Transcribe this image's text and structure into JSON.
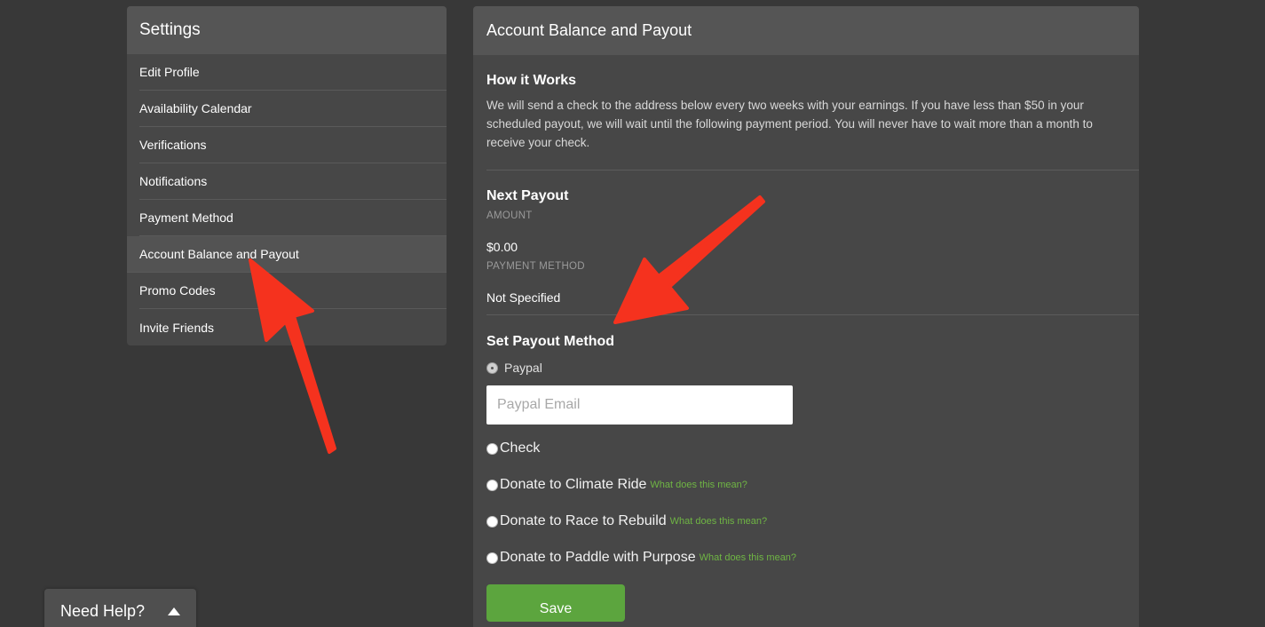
{
  "sidebar": {
    "title": "Settings",
    "items": [
      {
        "label": "Edit Profile"
      },
      {
        "label": "Availability Calendar"
      },
      {
        "label": "Verifications"
      },
      {
        "label": "Notifications"
      },
      {
        "label": "Payment Method"
      },
      {
        "label": "Account Balance and Payout",
        "active": true
      },
      {
        "label": "Promo Codes"
      },
      {
        "label": "Invite Friends"
      }
    ]
  },
  "panel": {
    "title": "Account Balance and Payout",
    "how_it_works": {
      "title": "How it Works",
      "text": "We will send a check to the address below every two weeks with your earnings. If you have less than $50 in your scheduled payout, we will wait until the following payment period. You will never have to wait more than a month to receive your check."
    },
    "next_payout": {
      "title": "Next Payout",
      "amount_label": "AMOUNT",
      "amount_value": "$0.00",
      "method_label": "PAYMENT METHOD",
      "method_value": "Not Specified"
    },
    "set_payout": {
      "title": "Set Payout Method",
      "paypal_label": "Paypal",
      "paypal_placeholder": "Paypal Email",
      "check_label": "Check",
      "donate_options": [
        {
          "label": "Donate to Climate Ride",
          "link": "What does this mean?"
        },
        {
          "label": "Donate to Race to Rebuild",
          "link": "What does this mean?"
        },
        {
          "label": "Donate to Paddle with Purpose",
          "link": "What does this mean?"
        }
      ],
      "save_label": "Save"
    }
  },
  "help_widget": {
    "label": "Need Help?",
    "icon": "caret-up-icon"
  },
  "colors": {
    "background": "#383838",
    "panel": "#474747",
    "header": "#555555",
    "accent_green": "#5ca53e",
    "link_green": "#6fb544",
    "annotation_red": "#f5321e"
  }
}
